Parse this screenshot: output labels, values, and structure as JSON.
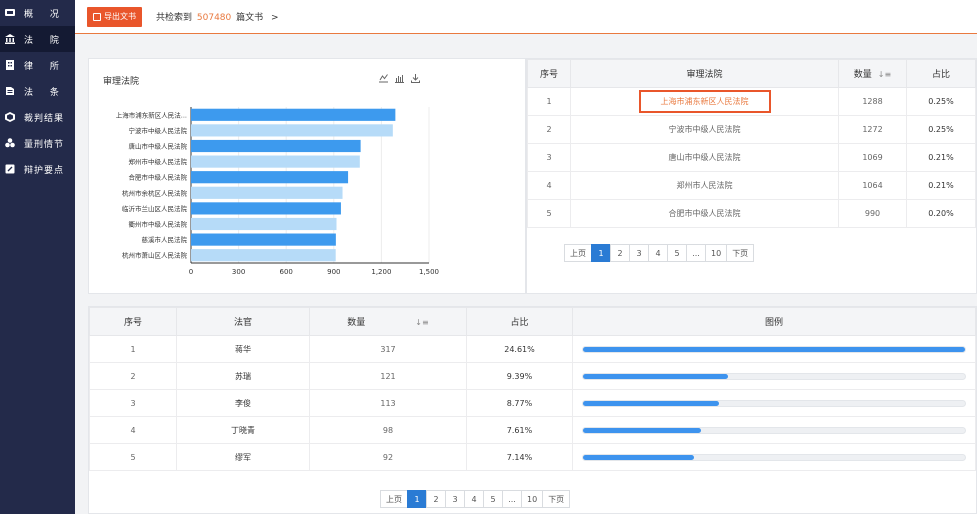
{
  "sidebar": {
    "items": [
      {
        "label": "概 况",
        "icon": "dashboard-icon"
      },
      {
        "label": "法 院",
        "icon": "court-icon"
      },
      {
        "label": "律 所",
        "icon": "law-firm-icon"
      },
      {
        "label": "法 条",
        "icon": "law-book-icon"
      },
      {
        "label": "裁判结果",
        "icon": "judgment-icon"
      },
      {
        "label": "量刑情节",
        "icon": "sentencing-icon"
      },
      {
        "label": "辩护要点",
        "icon": "defense-icon"
      }
    ]
  },
  "topbar": {
    "export_label": "导出文书",
    "summary_prefix": "共检索到",
    "summary_count": "507480",
    "summary_suffix": "篇文书",
    "chevron": ">"
  },
  "chart": {
    "title": "审理法院"
  },
  "chart_data": {
    "type": "bar",
    "orientation": "horizontal",
    "title": "审理法院",
    "categories": [
      "上海市浦东新区人民法...",
      "宁波市中级人民法院",
      "唐山市中级人民法院",
      "郑州市中级人民法院",
      "合肥市中级人民法院",
      "杭州市余杭区人民法院",
      "临沂市兰山区人民法院",
      "衢州市中级人民法院",
      "慈溪市人民法院",
      "杭州市萧山区人民法院"
    ],
    "values": [
      1288,
      1272,
      1069,
      1064,
      990,
      955,
      945,
      917,
      913,
      912
    ],
    "colors": [
      "#3d9aee",
      "#b6dbf8"
    ],
    "xticks": [
      "0",
      "300",
      "600",
      "900",
      "1,200",
      "1,500"
    ],
    "xlim": [
      0,
      1500
    ],
    "grid": true
  },
  "court_table": {
    "headers": {
      "index": "序号",
      "court": "审理法院",
      "count": "数量",
      "ratio": "占比"
    },
    "rows": [
      {
        "index": "1",
        "court": "上海市浦东新区人民法院",
        "count": "1288",
        "ratio": "0.25%"
      },
      {
        "index": "2",
        "court": "宁波市中级人民法院",
        "count": "1272",
        "ratio": "0.25%"
      },
      {
        "index": "3",
        "court": "唐山市中级人民法院",
        "count": "1069",
        "ratio": "0.21%"
      },
      {
        "index": "4",
        "court": "郑州市人民法院",
        "count": "1064",
        "ratio": "0.21%"
      },
      {
        "index": "5",
        "court": "合肥市中级人民法院",
        "count": "990",
        "ratio": "0.20%"
      }
    ]
  },
  "judge_table": {
    "headers": {
      "index": "序号",
      "judge": "法官",
      "count": "数量",
      "ratio": "占比",
      "legend": "图例"
    },
    "rows": [
      {
        "index": "1",
        "judge": "蒋华",
        "count": "317",
        "ratio": "24.61%",
        "fill": 1.0
      },
      {
        "index": "2",
        "judge": "苏瑞",
        "count": "121",
        "ratio": "9.39%",
        "fill": 0.38
      },
      {
        "index": "3",
        "judge": "李俊",
        "count": "113",
        "ratio": "8.77%",
        "fill": 0.356
      },
      {
        "index": "4",
        "judge": "丁晓青",
        "count": "98",
        "ratio": "7.61%",
        "fill": 0.309
      },
      {
        "index": "5",
        "judge": "缪军",
        "count": "92",
        "ratio": "7.14%",
        "fill": 0.29
      }
    ]
  },
  "pager": {
    "prev": "上页",
    "pages": [
      "1",
      "2",
      "3",
      "4",
      "5",
      "...",
      "10"
    ],
    "next": "下页",
    "current": "1"
  }
}
